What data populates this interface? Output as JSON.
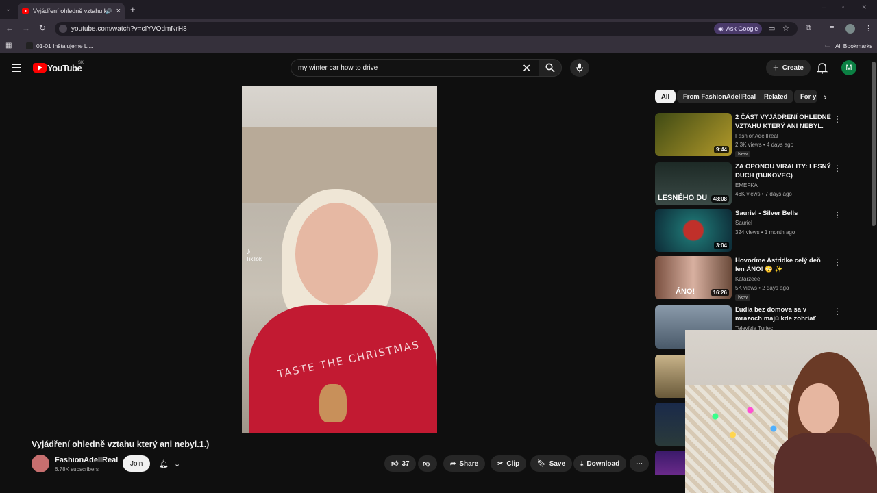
{
  "browser": {
    "tab_title": "Vyjádření ohledně vztahu k",
    "url": "youtube.com/watch?v=cIYVOdmNrH8",
    "ask_google": "Ask Google",
    "bookmark_item": "01-01 Inštalujeme Li...",
    "all_bookmarks": "All Bookmarks"
  },
  "header": {
    "logo_text": "YouTube",
    "region": "SK",
    "search_value": "my winter car how to drive",
    "create_label": "Create",
    "avatar_letter": "M"
  },
  "video": {
    "tiktok_label": "TikTok",
    "shirt_text": "TASTE THE CHRISTMAS",
    "title": "Vyjádření ohledně vztahu který ani nebyl.1.)",
    "channel": "FashionAdellReal",
    "subscribers": "6.78K subscribers",
    "join_label": "Join",
    "likes": "37",
    "share_label": "Share",
    "clip_label": "Clip",
    "save_label": "Save",
    "download_label": "Download"
  },
  "chips": [
    "All",
    "From FashionAdellReal",
    "Related",
    "For y"
  ],
  "recommendations": [
    {
      "title": "2 ČÁST VYJÁDŘENÍ OHLEDNĚ VZTAHU KTERÝ ANI NEBYL.",
      "channel": "FashionAdellReal",
      "meta": "2.3K views • 4 days ago",
      "badge": "New",
      "duration": "9:44",
      "color": "#7a8a2a"
    },
    {
      "title": "ZA OPONOU VIRALITY: LESNÝ DUCH (BUKOVEC)",
      "channel": "EMEFKA",
      "meta": "46K views • 7 days ago",
      "badge": "",
      "duration": "48:08",
      "color": "#2d3a36"
    },
    {
      "title": "Sauriel - Silver Bells",
      "channel": "Sauriel",
      "meta": "324 views • 1 month ago",
      "badge": "",
      "duration": "3:04",
      "color": "#1e6a6a"
    },
    {
      "title": "Hovoríme Astridke celý deň len ÁNO! 😳 ✨",
      "channel": "Katarzeee",
      "meta": "5K views • 2 days ago",
      "badge": "New",
      "duration": "16:26",
      "color": "#8a6a5a"
    },
    {
      "title": "Ľudia bez domova sa v mrazoch majú kde zohriať",
      "channel": "Televízia Turiec",
      "meta": "",
      "badge": "",
      "duration": "",
      "color": "#5a6a7a"
    }
  ],
  "colors": {
    "accent_red": "#ff0000",
    "bg": "#0f0f0f",
    "pill": "#272727"
  }
}
